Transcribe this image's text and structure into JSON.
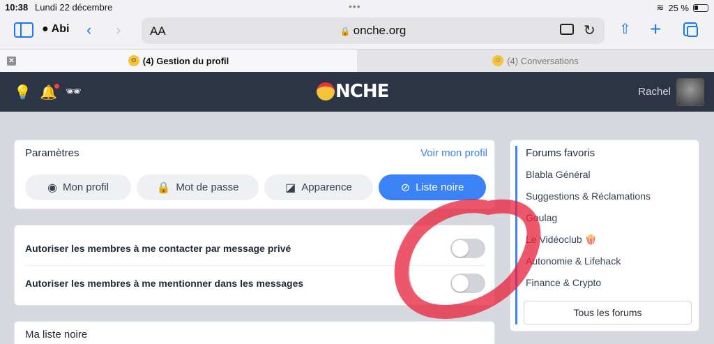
{
  "status": {
    "time": "10:38",
    "date": "Lundi 22 décembre",
    "battery": "25 %"
  },
  "toolbar": {
    "profile": "Abi",
    "aa": "AA",
    "url": "onche.org"
  },
  "tabs": [
    {
      "label": "(4) Gestion du profil",
      "active": true
    },
    {
      "label": "(4) Conversations",
      "active": false
    }
  ],
  "header": {
    "logo_text": "NCHE",
    "username": "Rachel"
  },
  "settings": {
    "title": "Paramètres",
    "view_profile": "Voir mon profil",
    "buttons": [
      {
        "label": "Mon profil",
        "icon": "user-circle-icon"
      },
      {
        "label": "Mot de passe",
        "icon": "lock-icon"
      },
      {
        "label": "Apparence",
        "icon": "brush-icon"
      },
      {
        "label": "Liste noire",
        "icon": "block-icon",
        "active": true
      }
    ]
  },
  "toggles": [
    {
      "label": "Autoriser les membres à me contacter par message privé",
      "on": false
    },
    {
      "label": "Autoriser les membres à me mentionner dans les messages",
      "on": false
    }
  ],
  "blacklist": {
    "title": "Ma liste noire"
  },
  "forums": {
    "title": "Forums favoris",
    "items": [
      "Blabla Général",
      "Suggestions & Réclamations",
      "Goulag",
      "Le Vidéoclub 🍿",
      "Autonomie & Lifehack",
      "Finance & Crypto"
    ],
    "all_label": "Tous les forums"
  },
  "colors": {
    "accent": "#3b82f6",
    "header_bg": "#2d3446",
    "annotation_red": "#e8203a"
  }
}
